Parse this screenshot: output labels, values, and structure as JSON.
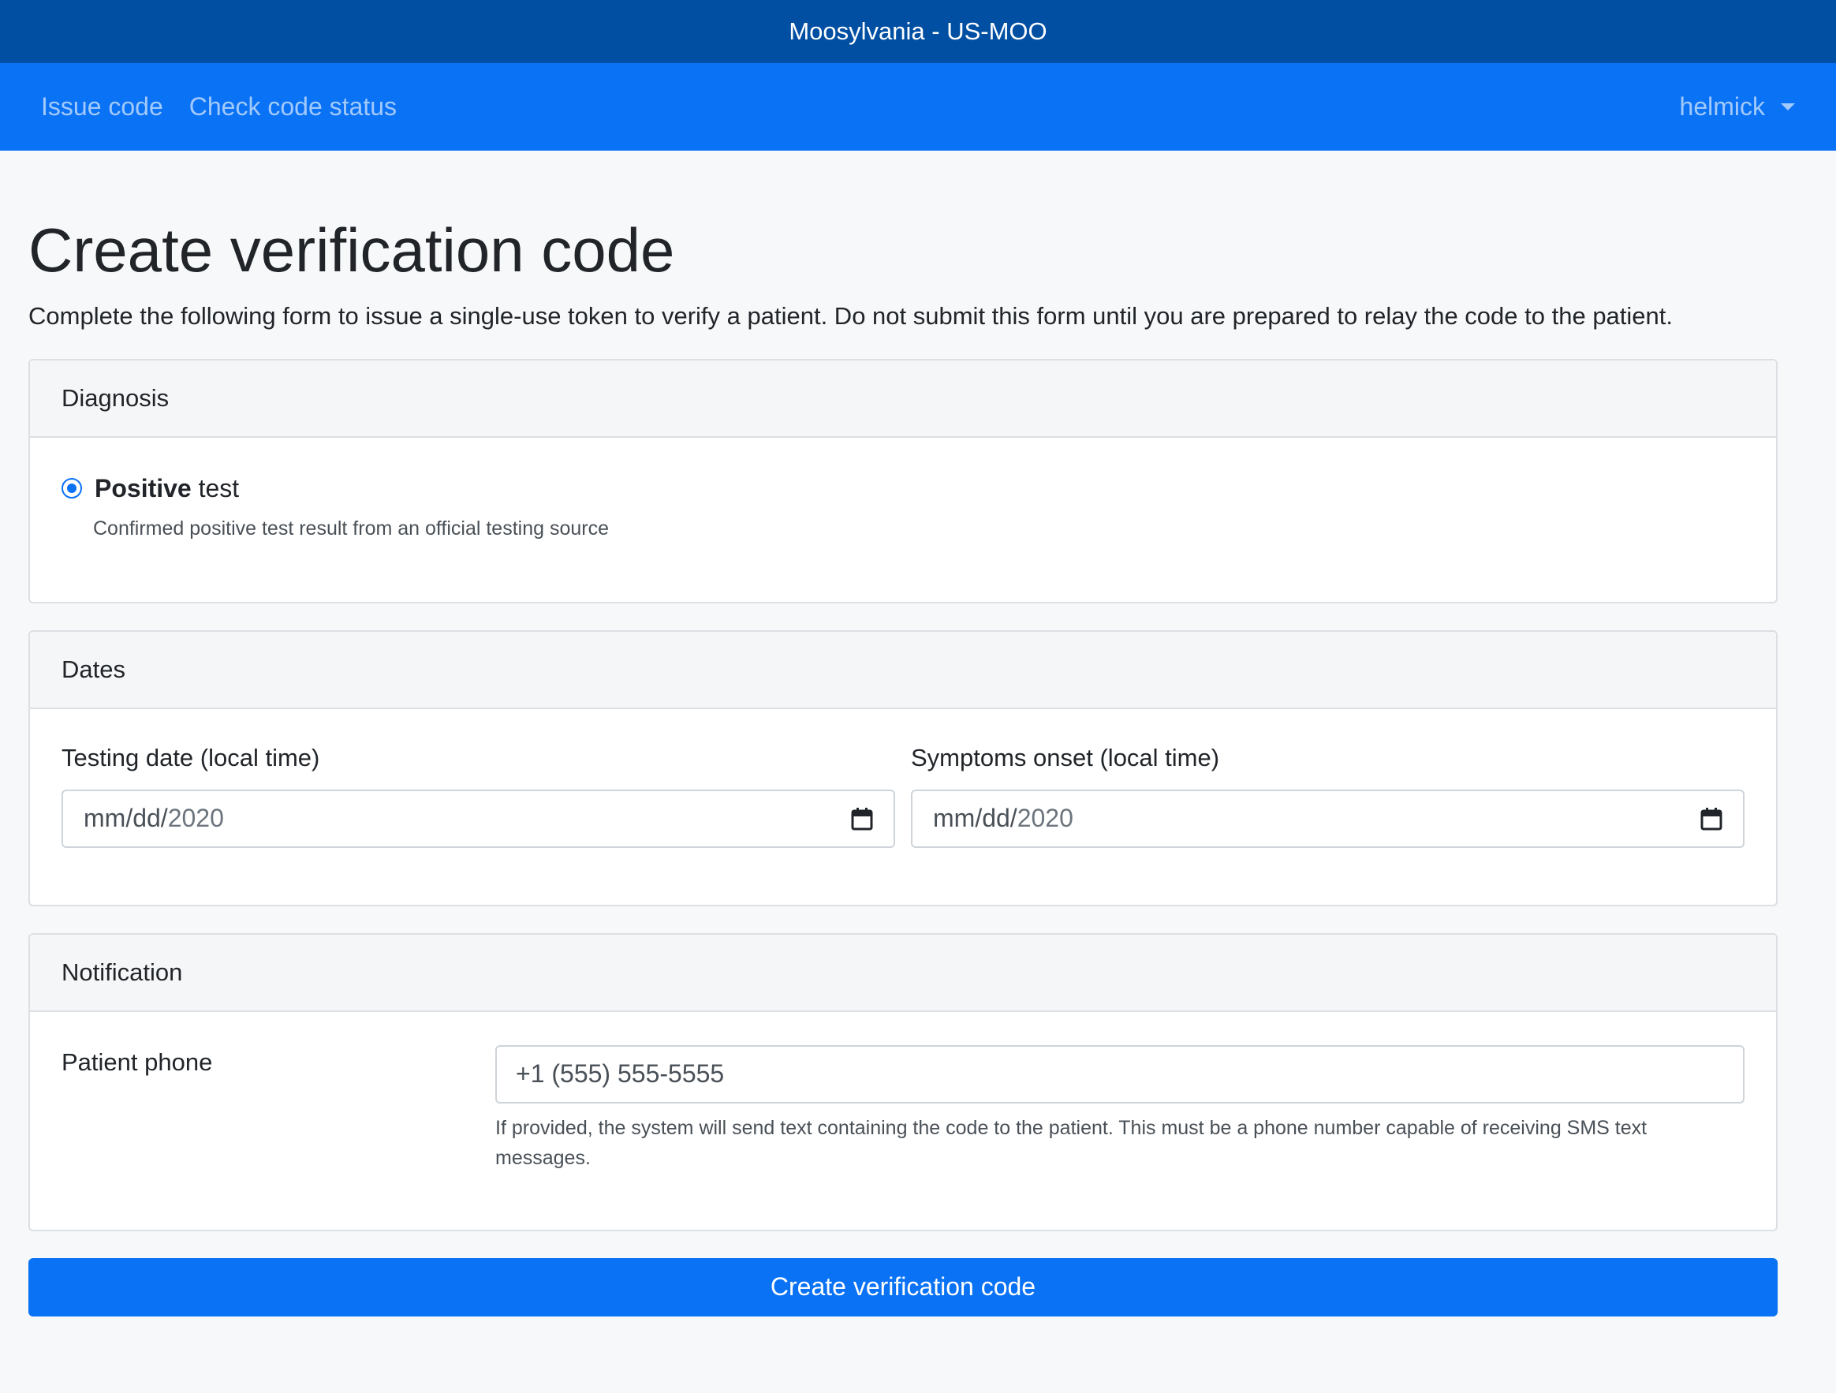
{
  "topbar": {
    "title": "Moosylvania - US-MOO"
  },
  "nav": {
    "links": [
      "Issue code",
      "Check code status"
    ],
    "user": "helmick"
  },
  "page": {
    "title": "Create verification code",
    "lead": "Complete the following form to issue a single-use token to verify a patient. Do not submit this form until you are prepared to relay the code to the patient."
  },
  "diagnosis": {
    "header": "Diagnosis",
    "option_bold": "Positive",
    "option_rest": " test",
    "option_help": "Confirmed positive test result from an official testing source",
    "selected": true
  },
  "dates": {
    "header": "Dates",
    "testing_label": "Testing date (local time)",
    "symptoms_label": "Symptoms onset (local time)",
    "testing_mask": "mm/dd/",
    "testing_year": "2020",
    "symptoms_mask": "mm/dd/",
    "symptoms_year": "2020"
  },
  "notification": {
    "header": "Notification",
    "phone_label": "Patient phone",
    "phone_placeholder": "+1 (555) 555-5555",
    "phone_help": "If provided, the system will send text containing the code to the patient. This must be a phone number capable of receiving SMS text messages."
  },
  "submit": {
    "label": "Create verification code"
  },
  "colors": {
    "primary": "#0a72f5",
    "topbar": "#004fa3"
  }
}
